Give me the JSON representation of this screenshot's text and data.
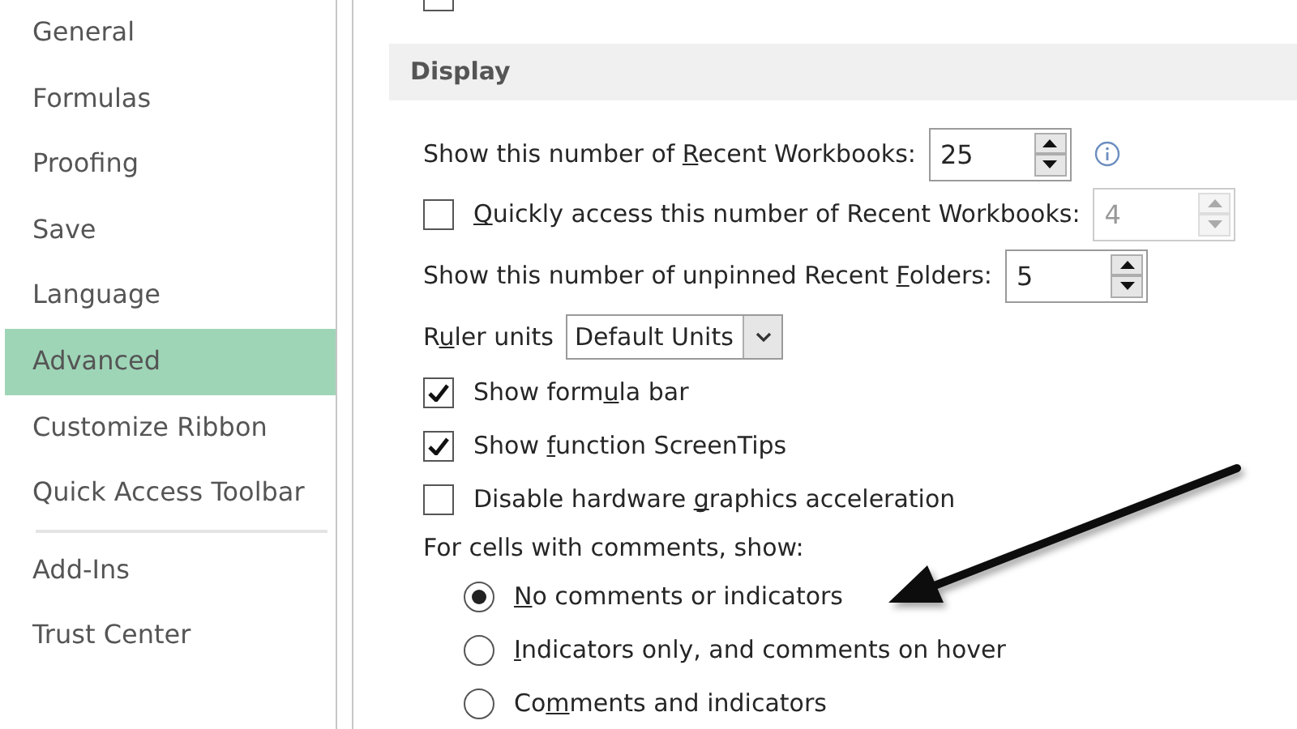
{
  "sidebar": {
    "items": [
      {
        "label": "General",
        "selected": false,
        "divider_after": false
      },
      {
        "label": "Formulas",
        "selected": false,
        "divider_after": false
      },
      {
        "label": "Proofing",
        "selected": false,
        "divider_after": false
      },
      {
        "label": "Save",
        "selected": false,
        "divider_after": false
      },
      {
        "label": "Language",
        "selected": false,
        "divider_after": false
      },
      {
        "label": "Advanced",
        "selected": true,
        "divider_after": false
      },
      {
        "label": "Customize Ribbon",
        "selected": false,
        "divider_after": false
      },
      {
        "label": "Quick Access Toolbar",
        "selected": false,
        "divider_after": true
      },
      {
        "label": "Add-Ins",
        "selected": false,
        "divider_after": false
      },
      {
        "label": "Trust Center",
        "selected": false,
        "divider_after": false
      }
    ]
  },
  "top_checkbox": {
    "checked": false
  },
  "section": {
    "title": "Display"
  },
  "options": [
    {
      "kind": "spinner",
      "label_parts": [
        {
          "text": "Show this number of ",
          "underline": false
        },
        {
          "text": "R",
          "underline": true
        },
        {
          "text": "ecent Workbooks:",
          "underline": false
        }
      ],
      "value": "25",
      "disabled": false,
      "info": true
    },
    {
      "kind": "checkspinner",
      "checked": false,
      "label_parts": [
        {
          "text": "Q",
          "underline": true
        },
        {
          "text": "uickly access this number of Recent Workbooks:",
          "underline": false
        }
      ],
      "value": "4",
      "disabled": true
    },
    {
      "kind": "spinner",
      "label_parts": [
        {
          "text": "Show this number of unpinned Recent ",
          "underline": false
        },
        {
          "text": "F",
          "underline": true
        },
        {
          "text": "olders:",
          "underline": false
        }
      ],
      "value": "5",
      "disabled": false
    },
    {
      "kind": "dropdown",
      "label_parts": [
        {
          "text": "R",
          "underline": false
        },
        {
          "text": "u",
          "underline": true
        },
        {
          "text": "ler units",
          "underline": false
        }
      ],
      "value": "Default Units"
    },
    {
      "kind": "checkbox",
      "checked": true,
      "label_parts": [
        {
          "text": "Show form",
          "underline": false
        },
        {
          "text": "u",
          "underline": true
        },
        {
          "text": "la bar",
          "underline": false
        }
      ]
    },
    {
      "kind": "checkbox",
      "checked": true,
      "label_parts": [
        {
          "text": "Show ",
          "underline": false
        },
        {
          "text": "f",
          "underline": true
        },
        {
          "text": "unction ScreenTips",
          "underline": false
        }
      ]
    },
    {
      "kind": "checkbox",
      "checked": false,
      "label_parts": [
        {
          "text": "Disable hardware ",
          "underline": false
        },
        {
          "text": "g",
          "underline": true
        },
        {
          "text": "raphics acceleration",
          "underline": false
        }
      ]
    },
    {
      "kind": "heading",
      "label_parts": [
        {
          "text": "For cells with comments, show:",
          "underline": false
        }
      ]
    },
    {
      "kind": "radio",
      "selected": true,
      "label_parts": [
        {
          "text": "N",
          "underline": true
        },
        {
          "text": "o comments or indicators",
          "underline": false
        }
      ]
    },
    {
      "kind": "radio",
      "selected": false,
      "label_parts": [
        {
          "text": "I",
          "underline": true
        },
        {
          "text": "ndicators only, and comments on hover",
          "underline": false
        }
      ]
    },
    {
      "kind": "radio",
      "selected": false,
      "label_parts": [
        {
          "text": "Co",
          "underline": false
        },
        {
          "text": "m",
          "underline": true
        },
        {
          "text": "ments and indicators",
          "underline": false
        }
      ]
    }
  ]
}
